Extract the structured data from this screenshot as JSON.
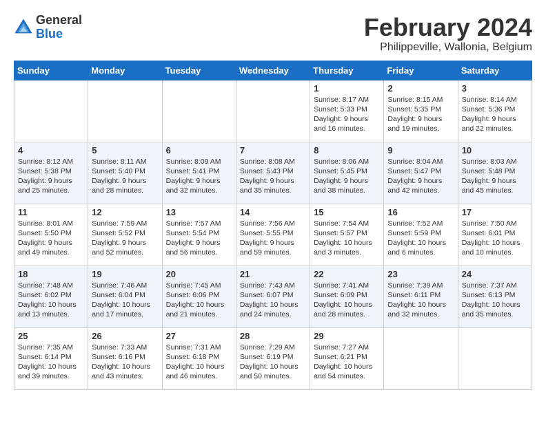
{
  "header": {
    "logo_general": "General",
    "logo_blue": "Blue",
    "month_year": "February 2024",
    "location": "Philippeville, Wallonia, Belgium"
  },
  "weekdays": [
    "Sunday",
    "Monday",
    "Tuesday",
    "Wednesday",
    "Thursday",
    "Friday",
    "Saturday"
  ],
  "weeks": [
    [
      {
        "day": "",
        "info": ""
      },
      {
        "day": "",
        "info": ""
      },
      {
        "day": "",
        "info": ""
      },
      {
        "day": "",
        "info": ""
      },
      {
        "day": "1",
        "info": "Sunrise: 8:17 AM\nSunset: 5:33 PM\nDaylight: 9 hours\nand 16 minutes."
      },
      {
        "day": "2",
        "info": "Sunrise: 8:15 AM\nSunset: 5:35 PM\nDaylight: 9 hours\nand 19 minutes."
      },
      {
        "day": "3",
        "info": "Sunrise: 8:14 AM\nSunset: 5:36 PM\nDaylight: 9 hours\nand 22 minutes."
      }
    ],
    [
      {
        "day": "4",
        "info": "Sunrise: 8:12 AM\nSunset: 5:38 PM\nDaylight: 9 hours\nand 25 minutes."
      },
      {
        "day": "5",
        "info": "Sunrise: 8:11 AM\nSunset: 5:40 PM\nDaylight: 9 hours\nand 28 minutes."
      },
      {
        "day": "6",
        "info": "Sunrise: 8:09 AM\nSunset: 5:41 PM\nDaylight: 9 hours\nand 32 minutes."
      },
      {
        "day": "7",
        "info": "Sunrise: 8:08 AM\nSunset: 5:43 PM\nDaylight: 9 hours\nand 35 minutes."
      },
      {
        "day": "8",
        "info": "Sunrise: 8:06 AM\nSunset: 5:45 PM\nDaylight: 9 hours\nand 38 minutes."
      },
      {
        "day": "9",
        "info": "Sunrise: 8:04 AM\nSunset: 5:47 PM\nDaylight: 9 hours\nand 42 minutes."
      },
      {
        "day": "10",
        "info": "Sunrise: 8:03 AM\nSunset: 5:48 PM\nDaylight: 9 hours\nand 45 minutes."
      }
    ],
    [
      {
        "day": "11",
        "info": "Sunrise: 8:01 AM\nSunset: 5:50 PM\nDaylight: 9 hours\nand 49 minutes."
      },
      {
        "day": "12",
        "info": "Sunrise: 7:59 AM\nSunset: 5:52 PM\nDaylight: 9 hours\nand 52 minutes."
      },
      {
        "day": "13",
        "info": "Sunrise: 7:57 AM\nSunset: 5:54 PM\nDaylight: 9 hours\nand 56 minutes."
      },
      {
        "day": "14",
        "info": "Sunrise: 7:56 AM\nSunset: 5:55 PM\nDaylight: 9 hours\nand 59 minutes."
      },
      {
        "day": "15",
        "info": "Sunrise: 7:54 AM\nSunset: 5:57 PM\nDaylight: 10 hours\nand 3 minutes."
      },
      {
        "day": "16",
        "info": "Sunrise: 7:52 AM\nSunset: 5:59 PM\nDaylight: 10 hours\nand 6 minutes."
      },
      {
        "day": "17",
        "info": "Sunrise: 7:50 AM\nSunset: 6:01 PM\nDaylight: 10 hours\nand 10 minutes."
      }
    ],
    [
      {
        "day": "18",
        "info": "Sunrise: 7:48 AM\nSunset: 6:02 PM\nDaylight: 10 hours\nand 13 minutes."
      },
      {
        "day": "19",
        "info": "Sunrise: 7:46 AM\nSunset: 6:04 PM\nDaylight: 10 hours\nand 17 minutes."
      },
      {
        "day": "20",
        "info": "Sunrise: 7:45 AM\nSunset: 6:06 PM\nDaylight: 10 hours\nand 21 minutes."
      },
      {
        "day": "21",
        "info": "Sunrise: 7:43 AM\nSunset: 6:07 PM\nDaylight: 10 hours\nand 24 minutes."
      },
      {
        "day": "22",
        "info": "Sunrise: 7:41 AM\nSunset: 6:09 PM\nDaylight: 10 hours\nand 28 minutes."
      },
      {
        "day": "23",
        "info": "Sunrise: 7:39 AM\nSunset: 6:11 PM\nDaylight: 10 hours\nand 32 minutes."
      },
      {
        "day": "24",
        "info": "Sunrise: 7:37 AM\nSunset: 6:13 PM\nDaylight: 10 hours\nand 35 minutes."
      }
    ],
    [
      {
        "day": "25",
        "info": "Sunrise: 7:35 AM\nSunset: 6:14 PM\nDaylight: 10 hours\nand 39 minutes."
      },
      {
        "day": "26",
        "info": "Sunrise: 7:33 AM\nSunset: 6:16 PM\nDaylight: 10 hours\nand 43 minutes."
      },
      {
        "day": "27",
        "info": "Sunrise: 7:31 AM\nSunset: 6:18 PM\nDaylight: 10 hours\nand 46 minutes."
      },
      {
        "day": "28",
        "info": "Sunrise: 7:29 AM\nSunset: 6:19 PM\nDaylight: 10 hours\nand 50 minutes."
      },
      {
        "day": "29",
        "info": "Sunrise: 7:27 AM\nSunset: 6:21 PM\nDaylight: 10 hours\nand 54 minutes."
      },
      {
        "day": "",
        "info": ""
      },
      {
        "day": "",
        "info": ""
      }
    ]
  ]
}
